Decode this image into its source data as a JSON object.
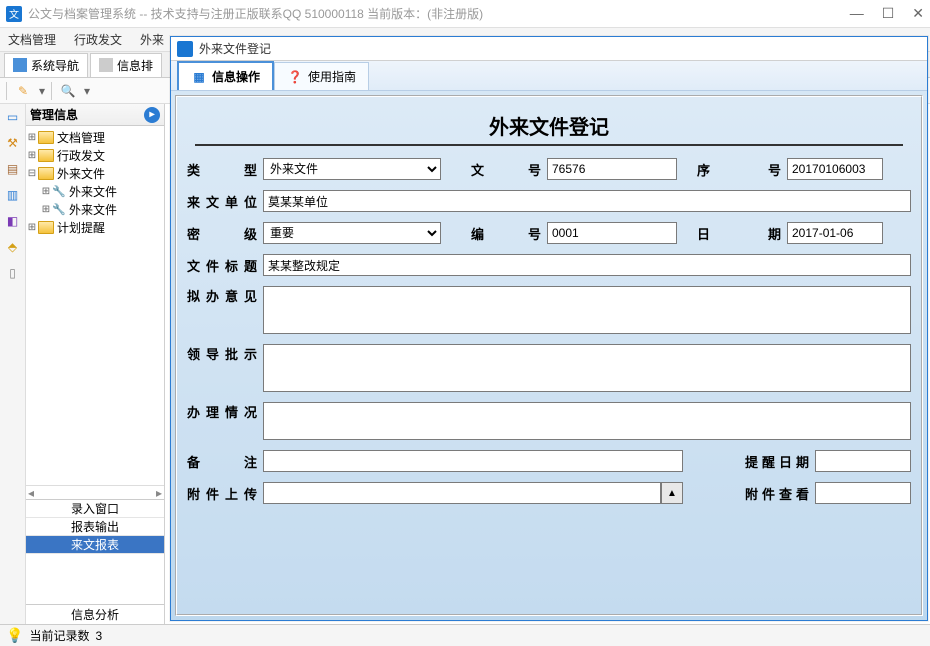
{
  "window": {
    "title": "公文与档案管理系统 -- 技术支持与注册正版联系QQ 510000118    当前版本：(非注册版)"
  },
  "menu": {
    "items": [
      "文档管理",
      "行政发文",
      "外来"
    ]
  },
  "navtabs": {
    "t1": "系统导航",
    "t2": "信息排"
  },
  "tree": {
    "header": "管理信息",
    "n1": "文档管理",
    "n2": "行政发文",
    "n3": "外来文件",
    "n3a": "外来文件",
    "n3b": "外来文件",
    "n4": "计划提醒"
  },
  "sidelist": {
    "i1": "录入窗口",
    "i2": "报表输出",
    "i3": "来文报表",
    "footer": "信息分析"
  },
  "status": {
    "label": "当前记录数",
    "value": "3"
  },
  "child": {
    "title": "外来文件登记",
    "tabs": {
      "t1": "信息操作",
      "t2": "使用指南"
    },
    "form_title": "外来文件登记",
    "labels": {
      "type": "类　　型",
      "docno": "文　　号",
      "seq": "序　　号",
      "from": "来文单位",
      "sec": "密　　级",
      "code": "编　　号",
      "date": "日　　期",
      "title": "文件标题",
      "opinion": "拟办意见",
      "approve": "领导批示",
      "handle": "办理情况",
      "remark": "备　　注",
      "remind": "提醒日期",
      "upload": "附件上传",
      "view": "附件查看"
    },
    "values": {
      "type": "外来文件",
      "docno": "76576",
      "seq": "20170106003",
      "from": "莫某某单位",
      "sec": "重要",
      "code": "0001",
      "date": "2017-01-06",
      "title": "某某整改规定",
      "opinion": "",
      "approve": "",
      "handle": "",
      "remark": "",
      "upload": ""
    }
  }
}
